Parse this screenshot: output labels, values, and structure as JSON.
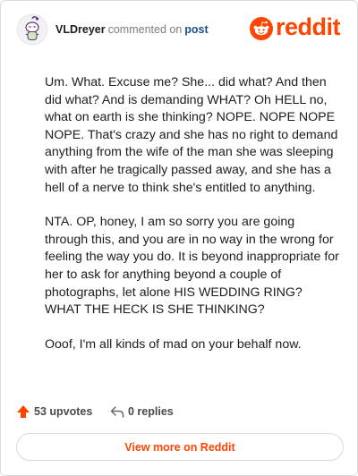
{
  "comment": {
    "author": "VLDreyer",
    "action": "commented on",
    "post_link": "post",
    "paragraphs": [
      "Um. What. Excuse me? She... did what? And then did what? And is demanding WHAT? Oh HELL no, what on earth is she thinking? NOPE. NOPE NOPE NOPE. That's crazy and she has no right to demand anything from the wife of the man she was sleeping with after he tragically passed away, and she has a hell of a nerve to think she's entitled to anything.",
      "NTA. OP, honey, I am so sorry you are going through this, and you are in no way in the wrong for feeling the way you do. It is beyond inappropriate for her to ask for anything beyond a couple of photographs, let alone HIS WEDDING RING? WHAT THE HECK IS SHE THINKING?",
      "Ooof, I'm all kinds of mad on your behalf now."
    ]
  },
  "brand": {
    "wordmark": "reddit",
    "icon": "reddit-snoo-icon",
    "color": "#ff4500"
  },
  "footer": {
    "upvotes": "53 upvotes",
    "replies": "0 replies",
    "upvote_icon": "upvote-arrow-icon",
    "reply_icon": "reply-arrow-icon"
  },
  "actions": {
    "view_more_label": "View more on Reddit"
  },
  "colors": {
    "accent": "#ff4500",
    "link": "#1c4e8a",
    "muted": "#7c7c7c",
    "border": "#d8dadd"
  }
}
